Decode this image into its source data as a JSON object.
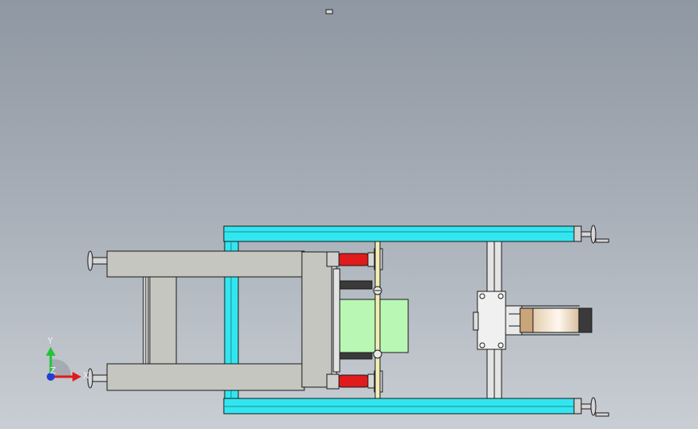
{
  "window": {
    "background_top": "#8f97a2",
    "background_bottom": "#c9ced4"
  },
  "model": {
    "frame_color": "#32e6f0",
    "plate_color": "#c5c6bf",
    "block_color": "#b9f7b4",
    "cylinder_color": "#e01b1b",
    "roller_color": "#e9d9c4",
    "outline_color": "#1a1a1a"
  },
  "triad": {
    "y_label": "Y",
    "x_label": "X",
    "z_label": "Z",
    "y_color": "#22c43a",
    "x_color": "#e01b1b",
    "z_color": "#1f3fd6"
  }
}
